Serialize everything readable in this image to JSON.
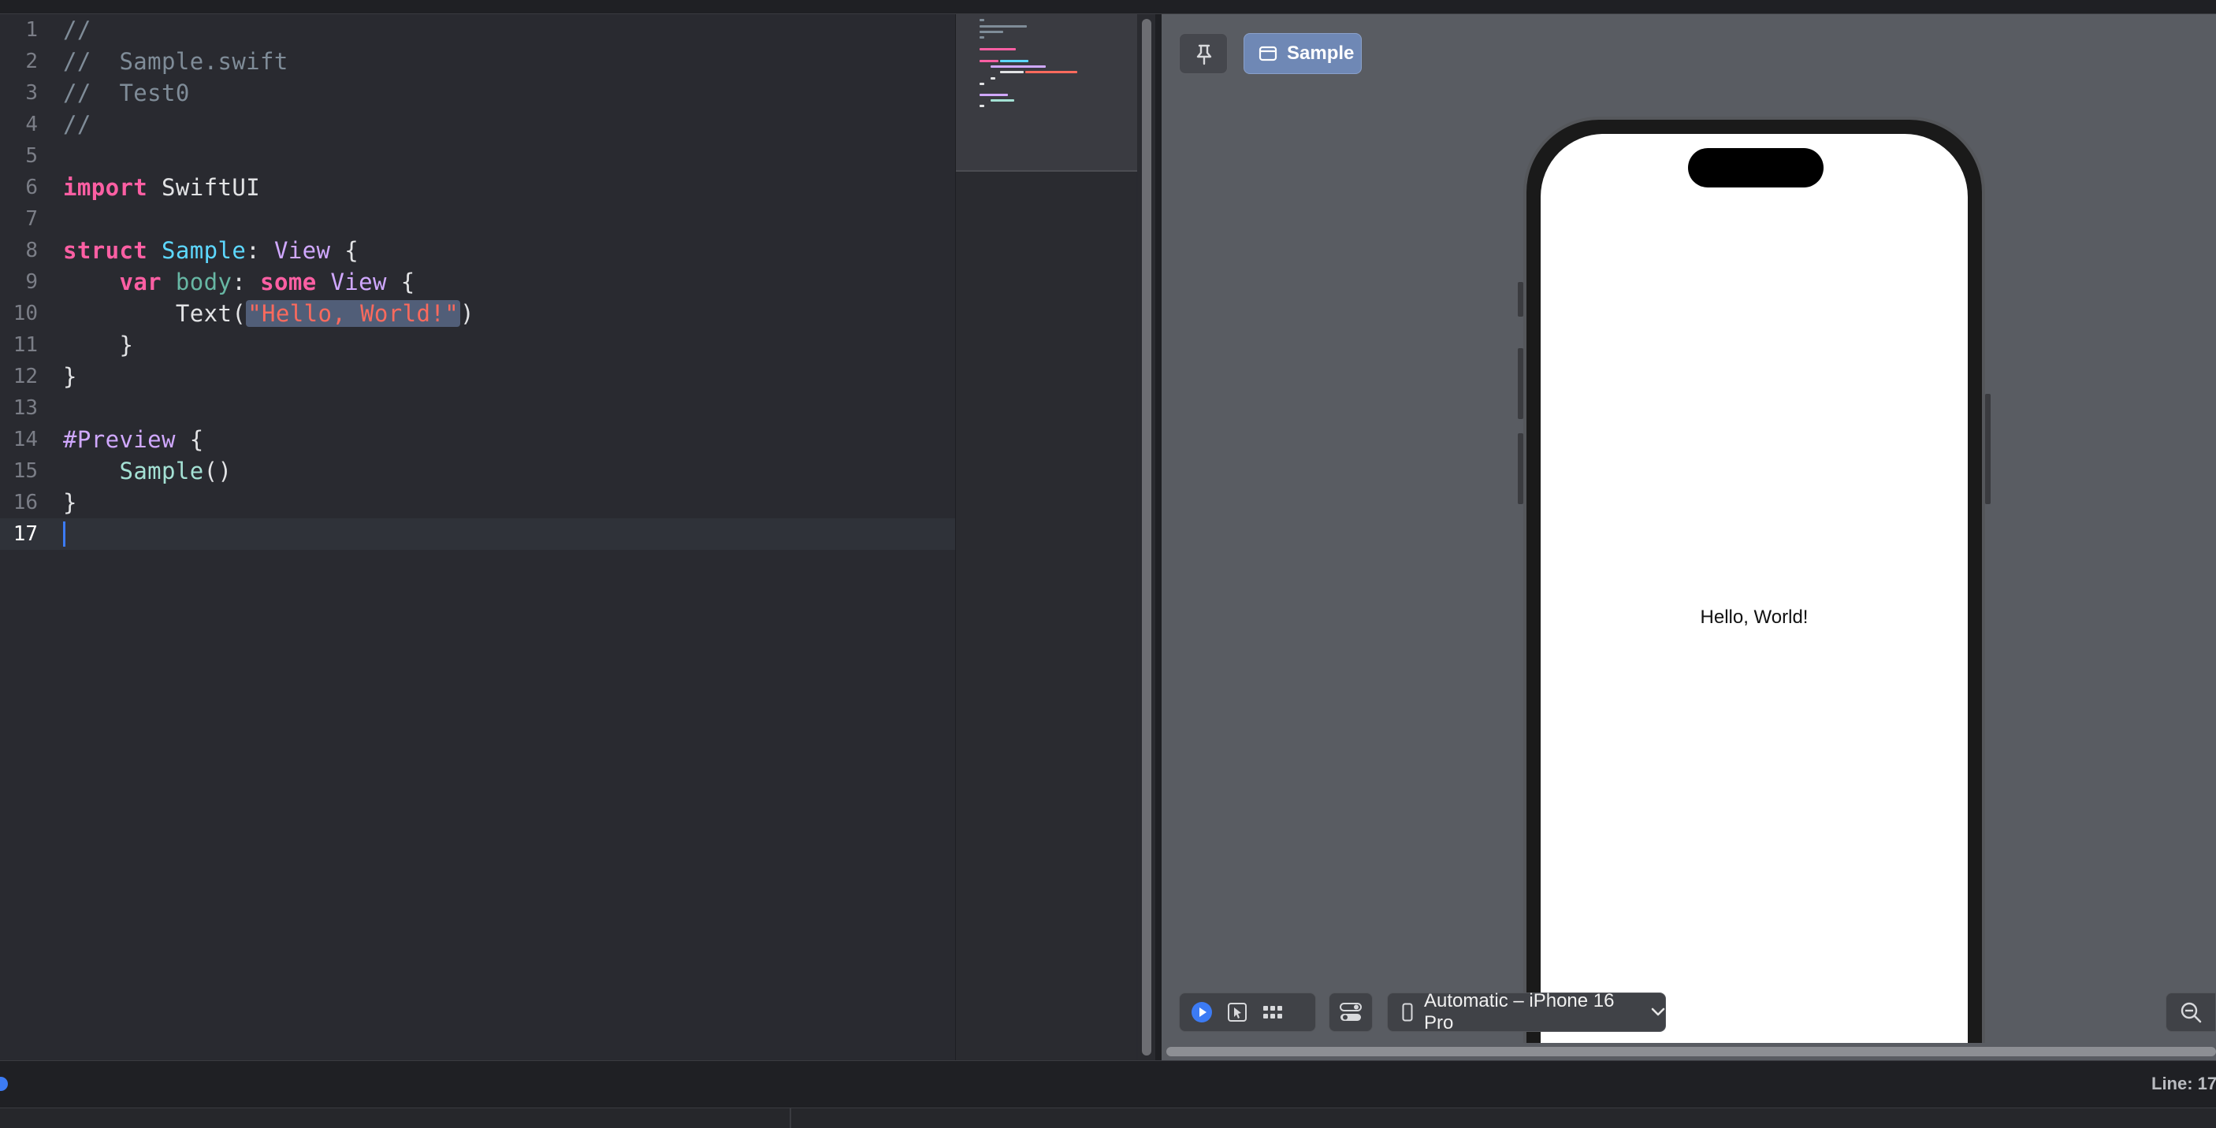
{
  "editor": {
    "lines": [
      {
        "num": "1",
        "tokens": [
          {
            "t": "//",
            "k": "comment"
          }
        ]
      },
      {
        "num": "2",
        "tokens": [
          {
            "t": "//  Sample.swift",
            "k": "comment"
          }
        ]
      },
      {
        "num": "3",
        "tokens": [
          {
            "t": "//  Test0",
            "k": "comment"
          }
        ]
      },
      {
        "num": "4",
        "tokens": [
          {
            "t": "//",
            "k": "comment"
          }
        ]
      },
      {
        "num": "5",
        "tokens": []
      },
      {
        "num": "6",
        "tokens": [
          {
            "t": "import",
            "k": "kw"
          },
          {
            "t": " SwiftUI",
            "k": "plain"
          }
        ]
      },
      {
        "num": "7",
        "tokens": []
      },
      {
        "num": "8",
        "tokens": [
          {
            "t": "struct",
            "k": "kw"
          },
          {
            "t": " ",
            "k": "plain"
          },
          {
            "t": "Sample",
            "k": "type"
          },
          {
            "t": ": ",
            "k": "plain"
          },
          {
            "t": "View",
            "k": "sys"
          },
          {
            "t": " {",
            "k": "plain"
          }
        ]
      },
      {
        "num": "9",
        "tokens": [
          {
            "t": "    ",
            "k": "plain"
          },
          {
            "t": "var",
            "k": "kw"
          },
          {
            "t": " ",
            "k": "plain"
          },
          {
            "t": "body",
            "k": "prop"
          },
          {
            "t": ": ",
            "k": "plain"
          },
          {
            "t": "some",
            "k": "kw"
          },
          {
            "t": " ",
            "k": "plain"
          },
          {
            "t": "View",
            "k": "sys"
          },
          {
            "t": " {",
            "k": "plain"
          }
        ]
      },
      {
        "num": "10",
        "tokens": [
          {
            "t": "        Text(",
            "k": "plain"
          },
          {
            "t": "\"Hello, World!\"",
            "k": "str-sel"
          },
          {
            "t": ")",
            "k": "plain"
          }
        ]
      },
      {
        "num": "11",
        "tokens": [
          {
            "t": "    }",
            "k": "plain"
          }
        ]
      },
      {
        "num": "12",
        "tokens": [
          {
            "t": "}",
            "k": "plain"
          }
        ]
      },
      {
        "num": "13",
        "tokens": []
      },
      {
        "num": "14",
        "tokens": [
          {
            "t": "#Preview",
            "k": "macro"
          },
          {
            "t": " {",
            "k": "plain"
          }
        ]
      },
      {
        "num": "15",
        "tokens": [
          {
            "t": "    ",
            "k": "plain"
          },
          {
            "t": "Sample",
            "k": "call"
          },
          {
            "t": "()",
            "k": "plain"
          }
        ]
      },
      {
        "num": "16",
        "tokens": [
          {
            "t": "}",
            "k": "plain"
          }
        ]
      },
      {
        "num": "17",
        "tokens": [],
        "current": true
      }
    ]
  },
  "canvas": {
    "pin_icon": "pin-icon",
    "preview_tab_label": "Sample",
    "preview_tab_icon": "window-icon",
    "preview_text": "Hello, World!",
    "device_label": "Automatic – iPhone 16 Pro",
    "toolbar_icons": [
      "live-play-icon",
      "selectable-pointer-icon",
      "variants-grid-icon",
      "device-settings-icon",
      "iphone-icon",
      "chevron-down-icon",
      "zoom-out-icon"
    ]
  },
  "statusbar": {
    "line_indicator": "Line: 17"
  },
  "colors": {
    "editor_bg": "#292a30",
    "canvas_bg": "#595c62",
    "accent": "#3c7bf4",
    "keyword": "#fc5fa3",
    "string": "#fc6a5d",
    "type": "#5dd8ff",
    "comment": "#7f8c98",
    "preview_tab_bg": "#6f88b5"
  }
}
